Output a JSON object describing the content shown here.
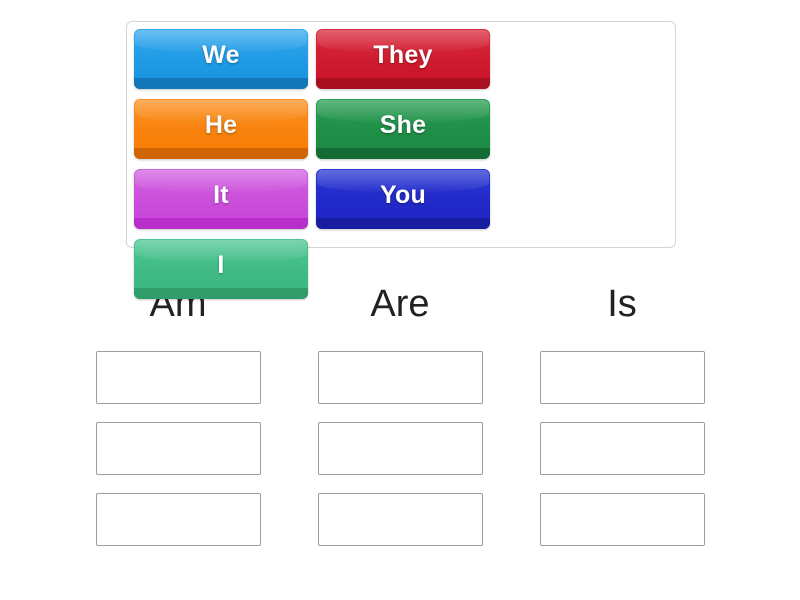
{
  "activity": {
    "type": "group-sort",
    "word_bank": {
      "tiles": [
        {
          "label": "We",
          "color": "#1f9ae4",
          "color_name": "blue"
        },
        {
          "label": "They",
          "color": "#cf1b2e",
          "color_name": "red"
        },
        {
          "label": "He",
          "color": "#f9820d",
          "color_name": "orange"
        },
        {
          "label": "She",
          "color": "#1f8f48",
          "color_name": "green"
        },
        {
          "label": "It",
          "color": "#cb4ddb",
          "color_name": "magenta"
        },
        {
          "label": "You",
          "color": "#2129c9",
          "color_name": "dark-blue"
        },
        {
          "label": "I",
          "color": "#41bb86",
          "color_name": "sea-green"
        }
      ]
    },
    "categories": [
      {
        "title": "Am",
        "slots": [
          "",
          "",
          ""
        ]
      },
      {
        "title": "Are",
        "slots": [
          "",
          "",
          ""
        ]
      },
      {
        "title": "Is",
        "slots": [
          "",
          "",
          ""
        ]
      }
    ]
  }
}
